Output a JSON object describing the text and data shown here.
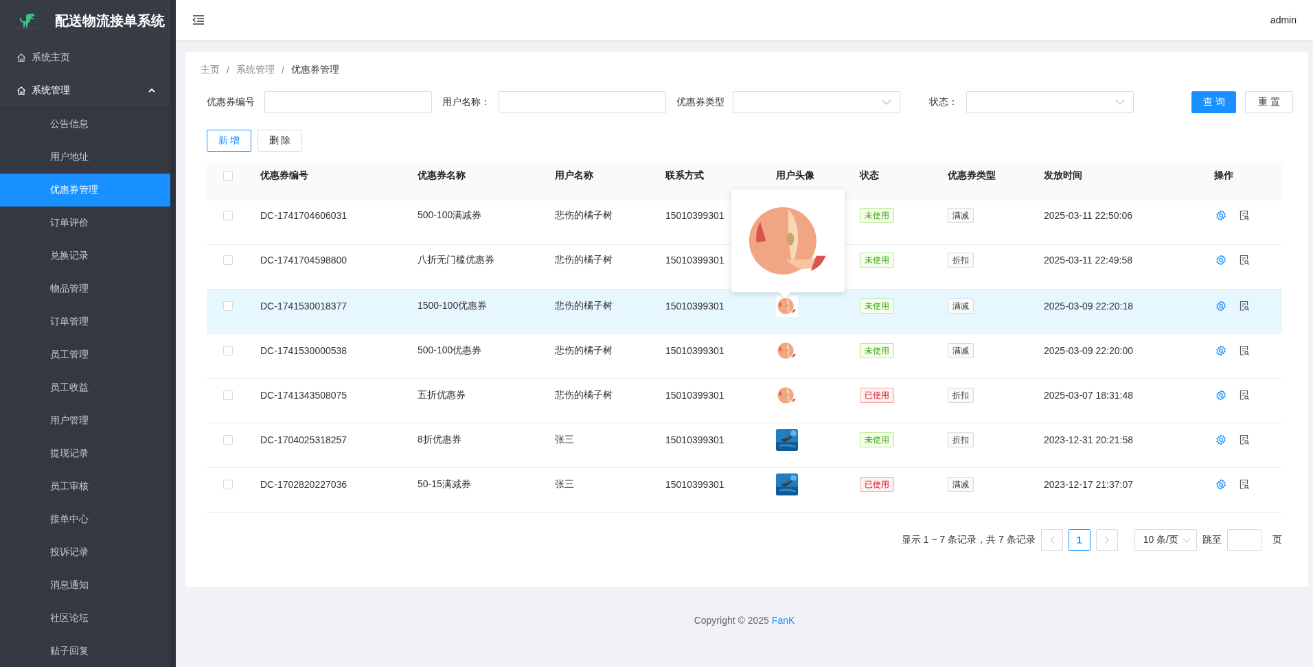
{
  "app": {
    "title": "配送物流接单系统"
  },
  "header": {
    "user": "admin"
  },
  "sidebar": {
    "items": [
      {
        "label": "系统主页",
        "kind": "link",
        "selected": false
      },
      {
        "label": "系统管理",
        "kind": "group",
        "expanded": true,
        "selected": false,
        "children": [
          {
            "label": "公告信息",
            "selected": false
          },
          {
            "label": "用户地址",
            "selected": false
          },
          {
            "label": "优惠券管理",
            "selected": true
          },
          {
            "label": "订单评价",
            "selected": false
          },
          {
            "label": "兑换记录",
            "selected": false
          },
          {
            "label": "物品管理",
            "selected": false
          },
          {
            "label": "订单管理",
            "selected": false
          },
          {
            "label": "员工管理",
            "selected": false
          },
          {
            "label": "员工收益",
            "selected": false
          },
          {
            "label": "用户管理",
            "selected": false
          },
          {
            "label": "提现记录",
            "selected": false
          },
          {
            "label": "员工审核",
            "selected": false
          },
          {
            "label": "接单中心",
            "selected": false
          },
          {
            "label": "投诉记录",
            "selected": false
          },
          {
            "label": "消息通知",
            "selected": false
          },
          {
            "label": "社区论坛",
            "selected": false
          },
          {
            "label": "贴子回复",
            "selected": false
          }
        ]
      }
    ]
  },
  "breadcrumb": {
    "items": [
      "主页",
      "系统管理",
      "优惠券管理"
    ],
    "separator": "/"
  },
  "filters": [
    {
      "label": "优惠券编号",
      "kind": "text"
    },
    {
      "label": "用户名称：",
      "kind": "text"
    },
    {
      "label": "优惠券类型",
      "kind": "select"
    },
    {
      "label": "状态：",
      "kind": "select"
    }
  ],
  "filter_buttons": [
    {
      "label": "查 询",
      "kind": "primary"
    },
    {
      "label": "重 置",
      "kind": "plain"
    }
  ],
  "actions": [
    {
      "label": "新 增",
      "kind": "outline"
    },
    {
      "label": "删 除",
      "kind": "plain"
    }
  ],
  "table": {
    "header_checked": false,
    "columns": [
      "优惠券编号",
      "优惠券名称",
      "用户名称",
      "联系方式",
      "用户头像",
      "状态",
      "优惠券类型",
      "发放时间",
      "操作"
    ],
    "rows": [
      {
        "checked": false,
        "selected": false,
        "code": "DC-1741704606031",
        "name": "500-100满减券",
        "user": "悲伤的橘子树",
        "phone": "15010399301",
        "status": {
          "text": "未使用",
          "kind": "unused"
        },
        "type": "满减",
        "time": "2025-03-11 22:50:06"
      },
      {
        "checked": false,
        "selected": false,
        "code": "DC-1741704598800",
        "name": "八折无门槛优惠券",
        "user": "悲伤的橘子树",
        "phone": "15010399301",
        "status": {
          "text": "未使用",
          "kind": "unused"
        },
        "type": "折扣",
        "time": "2025-03-11 22:49:58"
      },
      {
        "checked": false,
        "selected": true,
        "preview_open": true,
        "code": "DC-1741530018377",
        "name": "1500-100优惠券",
        "user": "悲伤的橘子树",
        "phone": "15010399301",
        "status": {
          "text": "未使用",
          "kind": "unused"
        },
        "type": "满减",
        "time": "2025-03-09 22:20:18"
      },
      {
        "checked": false,
        "selected": false,
        "code": "DC-1741530000538",
        "name": "500-100优惠券",
        "user": "悲伤的橘子树",
        "phone": "15010399301",
        "status": {
          "text": "未使用",
          "kind": "unused"
        },
        "type": "满减",
        "time": "2025-03-09 22:20:00"
      },
      {
        "checked": false,
        "selected": false,
        "code": "DC-1741343508075",
        "name": "五折优惠券",
        "user": "悲伤的橘子树",
        "phone": "15010399301",
        "status": {
          "text": "已使用",
          "kind": "used"
        },
        "type": "折扣",
        "time": "2025-03-07 18:31:48"
      },
      {
        "checked": false,
        "selected": false,
        "code": "DC-1704025318257",
        "name": "8折优惠券",
        "user": "张三",
        "phone": "15010399301",
        "status": {
          "text": "未使用",
          "kind": "unused"
        },
        "type": "折扣",
        "time": "2023-12-31 20:21:58"
      },
      {
        "checked": false,
        "selected": false,
        "code": "DC-1702820227036",
        "name": "50-15满减券",
        "user": "张三",
        "phone": "15010399301",
        "status": {
          "text": "已使用",
          "kind": "used"
        },
        "type": "满减",
        "time": "2023-12-17 21:37:07"
      }
    ]
  },
  "pagination": {
    "summary": "显示 1 ~ 7 条记录，共 7 条记录",
    "pages": [
      {
        "label": "1",
        "selected": true
      }
    ],
    "page_size": "10 条/页",
    "jump_label": "跳至",
    "page_suffix": "页"
  },
  "footer": {
    "text": "Copyright © 2025",
    "link": "FanK"
  }
}
